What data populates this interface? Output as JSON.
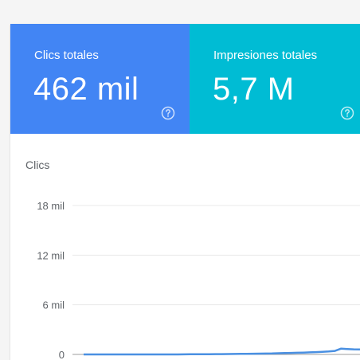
{
  "cards": {
    "clicks": {
      "label": "Clics totales",
      "value": "462 mil",
      "color": "#4285f4"
    },
    "impressions": {
      "label": "Impresiones totales",
      "value": "5,7 M",
      "color": "#00bcd4"
    }
  },
  "chart": {
    "title": "Clics",
    "line_color": "#4a90e2"
  },
  "chart_data": {
    "type": "line",
    "title": "Clics",
    "xlabel": "",
    "ylabel": "Clics",
    "ylim": [
      0,
      18000
    ],
    "yticks": [
      {
        "value": 0,
        "label": "0"
      },
      {
        "value": 6000,
        "label": "6 mil"
      },
      {
        "value": 12000,
        "label": "12 mil"
      },
      {
        "value": 18000,
        "label": "18 mil"
      }
    ],
    "grid": true,
    "series": [
      {
        "values": [
          0,
          0,
          0,
          0,
          0,
          0,
          0,
          0,
          0,
          0,
          0,
          0,
          0,
          0,
          0,
          0,
          10,
          20,
          20,
          30,
          30,
          40,
          40,
          50,
          60,
          70,
          80,
          90,
          100,
          110,
          120,
          140,
          160,
          180,
          200,
          220,
          250,
          280,
          320,
          360,
          420,
          700,
          650,
          620,
          600
        ]
      }
    ]
  }
}
